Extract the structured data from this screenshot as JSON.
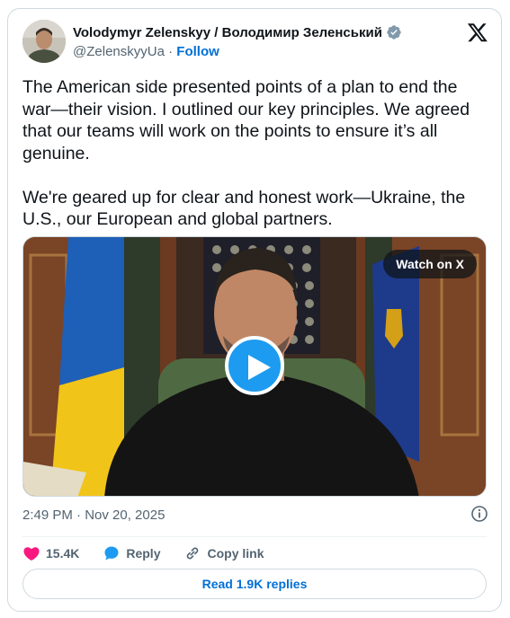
{
  "author": {
    "display_name": "Volodymyr Zelenskyy / Володимир Зеленський",
    "handle": "@ZelenskyyUa",
    "separator": "·",
    "follow_label": "Follow",
    "verified": true
  },
  "tweet": {
    "text": "The American side presented points of a plan to end the war—their vision. I outlined our key principles. We agreed that our teams will work on the points to ensure it’s all genuine.\n\nWe're geared up for clear and honest work—Ukraine, the U.S., our European and global partners."
  },
  "media": {
    "watch_label": "Watch on X",
    "play_icon": "play-icon"
  },
  "meta": {
    "timestamp": "2:49 PM · Nov 20, 2025",
    "info_icon": "info-icon"
  },
  "actions": {
    "like_count": "15.4K",
    "reply_label": "Reply",
    "copy_link_label": "Copy link"
  },
  "read_replies_label": "Read 1.9K replies",
  "colors": {
    "link_blue": "#006fd6",
    "verified_blue": "#1d9bf0",
    "like_pink": "#f91880",
    "secondary_text": "#536471",
    "border": "#cfd9de"
  }
}
